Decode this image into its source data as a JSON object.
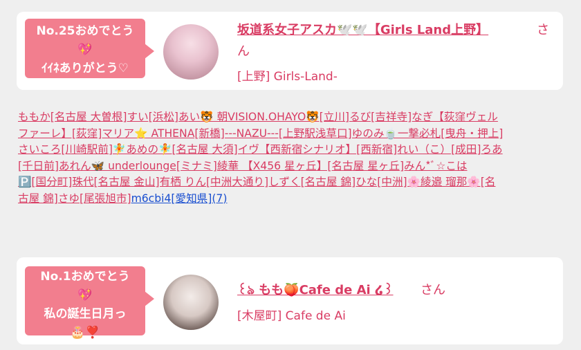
{
  "card1": {
    "badge_line1": "No.25おめでとう",
    "badge_line2": "💖",
    "badge_line3": "ｲｲﾈありがとう♡",
    "name": "坂道系女子アスカ🕊️🕊️【Girls Land上野】",
    "san_1": "さ",
    "san_2": "ん",
    "shop": "[上野] Girls-Land-"
  },
  "paragraph": {
    "line1": "ももか[名古屋 大曽根]すい[浜松]あい🐯 朝VISION.OHAYO🐯[立川]るび[吉祥寺]なぎ【荻窪ヴェル",
    "line2": "ファーレ】[荻窪]マリア⭐ ATHENA[新橋]---NAZU---[上野駅浅草口]ゆのみ🍵一撃必札[曳舟・押上]",
    "line3": "さいころ[川崎駅前]🧚あめの🧚[名古屋 大須]イヴ【西新宿シナリオ】[西新宿]れい（こ）[成田]ろあ",
    "line4": "[千日前]あれん🦋 underlounge[ミナミ]綾華 【X456 星ヶ丘】[名古屋 星ヶ丘]みん*ﾞ☆こは",
    "line5": "🅿️[国分町]珠代[名古屋 金山]有栖 りん[中洲大通り]しずく[名古屋 錦]ひな[中洲]🌸綾邉 瑠那🌸[名",
    "line6_a": "古屋 錦]さゆ[尾張旭市]",
    "line6_b": "m6cbi4[愛知県](7)"
  },
  "card2": {
    "badge_line1": "No.1おめでとう",
    "badge_line2": "💖",
    "badge_line3": "私の誕生日月っ",
    "badge_line4": "🎂❣️",
    "name": "꒰ঌ もも🍑Cafe de Ai ໒꒱",
    "san": "さん",
    "shop": "[木屋町] Cafe de Ai"
  },
  "colors": {
    "accent": "#d93c63",
    "badge": "#f27e8e",
    "link_blue": "#1a4fd0",
    "background": "#efefef"
  }
}
